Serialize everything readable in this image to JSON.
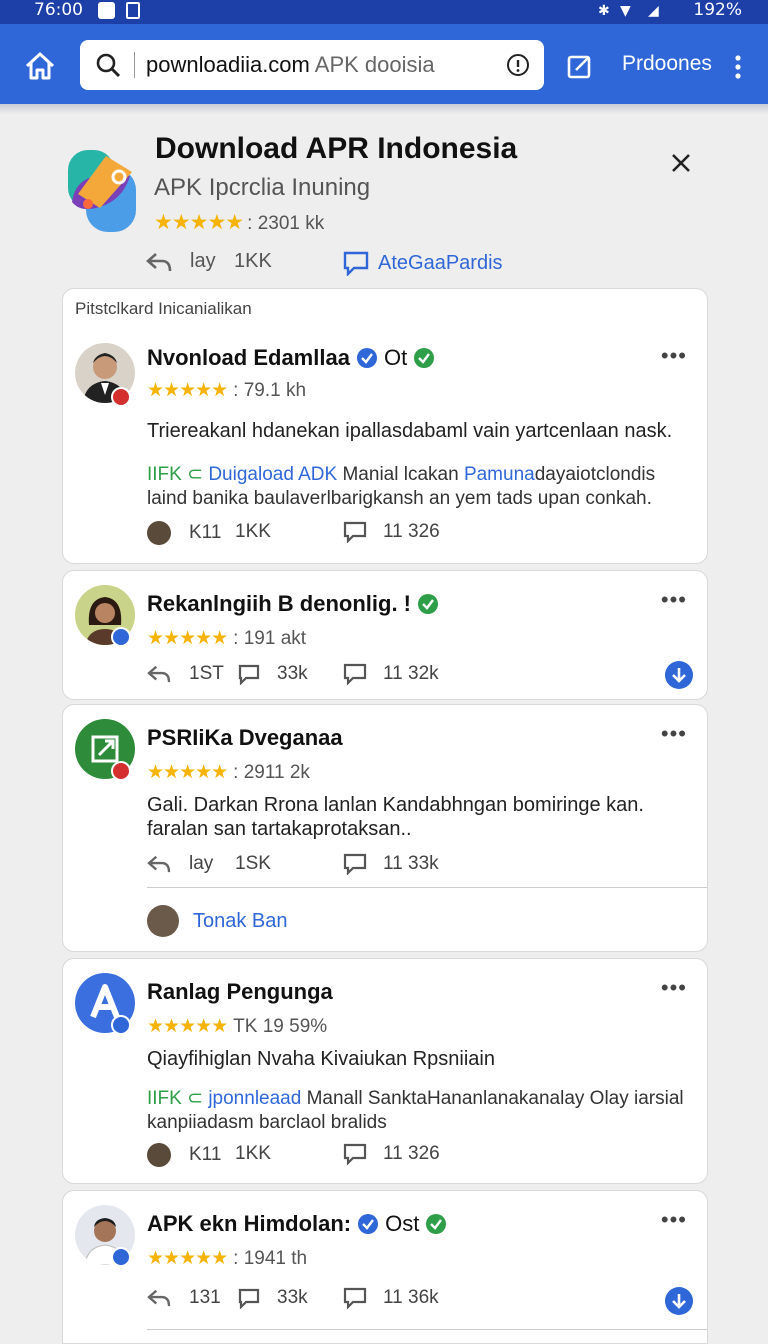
{
  "status": {
    "time": "76:00",
    "battery": "192%"
  },
  "toolbar": {
    "url_domain": "pownloadiia.com",
    "url_rest": " APK dooisia",
    "right_label": "Prdoones"
  },
  "app": {
    "title": "Download APR Indonesia",
    "subtitle": "APK Ipcrclia Inuning",
    "stars": "★★★★★",
    "rating": ": 2301 kk",
    "actions": [
      "lay",
      "1KK"
    ],
    "link": "AteGaaPardis"
  },
  "cards": [
    {
      "section_label": "Pitstclkard Inicanialikan",
      "title": "Nvonload Edamllaa",
      "title_suffix": "Ot",
      "stars": "★★★★★",
      "rating": ": 79.1 kh",
      "body1": "Triereakanl hdanekan ipallasdabaml vain yartcenlaan nask.",
      "body2_prefix": "IIFK ⊂",
      "body2_link": "Duigaload ADK",
      "body2_rest": " Manial lcakan ",
      "body2_link2": "Pamuna",
      "body2_rest2": "dayaiotclondis laind banika baulaverlbarigkansh an yem tads upan conkah.",
      "foot": [
        "K11",
        "1KK",
        "11 326"
      ]
    },
    {
      "title": "Rekanlngiih B denonlig. !",
      "stars": "★★★★★",
      "rating": ": 191 akt",
      "foot": [
        "1ST",
        "33k",
        "11 32k"
      ]
    },
    {
      "title": "PSRIiKa Dveganaa",
      "stars": "★★★★★",
      "rating": ": 2911 2k",
      "body1": "Gali. Darkan Rrona lanlan Kandabhngan bomiringe kan. faralan san tartakaprotaksan..",
      "foot": [
        "lay",
        "1SK",
        "11 33k"
      ],
      "reply": "Tonak Ban"
    },
    {
      "title": "Ranlag Pengunga",
      "stars": "★★★★★",
      "rating": "TK 19 59%",
      "body1": "Qiayfihiglan Nvaha Kivaiukan Rpsniiain",
      "body2_prefix": "IIFK ⊂",
      "body2_link": "jponnleaad",
      "body2_rest": " Manall SanktaHananlanakanalay Olay iarsial kanpiiadasm barclaol bralids",
      "foot": [
        "K11",
        "1KK",
        "11 326"
      ]
    },
    {
      "title": "APK ekn Himdolan:",
      "title_suffix": "Ost",
      "stars": "★★★★★",
      "rating": ": 1941 th",
      "foot": [
        "131",
        "33k",
        "11 36k"
      ]
    }
  ]
}
